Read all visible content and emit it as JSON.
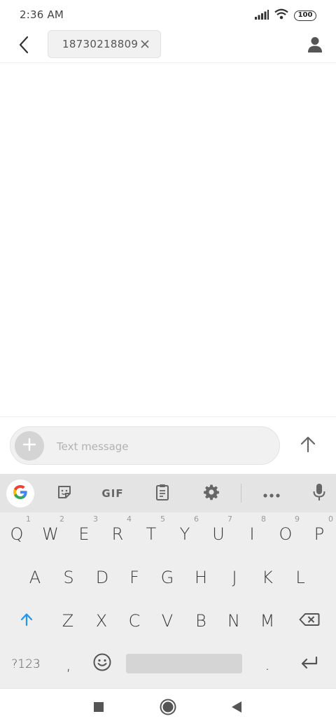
{
  "status_bar": {
    "time": "2:36 AM",
    "battery": "100",
    "icons": [
      "signal-icon",
      "wifi-icon",
      "battery-icon"
    ]
  },
  "header": {
    "recipient": "18730218809",
    "icons": [
      "back-arrow-icon",
      "close-icon",
      "contact-icon"
    ]
  },
  "compose": {
    "placeholder": "Text message",
    "icons": [
      "plus-icon",
      "send-arrow-icon"
    ]
  },
  "keyboard": {
    "toolbar": {
      "gif_label": "GIF",
      "icons": [
        "google-icon",
        "sticker-icon",
        "clipboard-icon",
        "settings-icon",
        "more-icon",
        "mic-icon"
      ]
    },
    "row1": [
      {
        "key": "Q",
        "hint": "1"
      },
      {
        "key": "W",
        "hint": "2"
      },
      {
        "key": "E",
        "hint": "3"
      },
      {
        "key": "R",
        "hint": "4"
      },
      {
        "key": "T",
        "hint": "5"
      },
      {
        "key": "Y",
        "hint": "6"
      },
      {
        "key": "U",
        "hint": "7"
      },
      {
        "key": "I",
        "hint": "8"
      },
      {
        "key": "O",
        "hint": "9"
      },
      {
        "key": "P",
        "hint": "0"
      }
    ],
    "row2": [
      "A",
      "S",
      "D",
      "F",
      "G",
      "H",
      "J",
      "K",
      "L"
    ],
    "row3": [
      "Z",
      "X",
      "C",
      "V",
      "B",
      "N",
      "M"
    ],
    "row4": {
      "symbols": "?123",
      "comma": ",",
      "period": "."
    },
    "icons": [
      "shift-icon",
      "backspace-icon",
      "emoji-icon",
      "enter-icon"
    ]
  },
  "nav_bar": {
    "icons": [
      "recents-icon",
      "home-icon",
      "back-icon"
    ]
  },
  "colors": {
    "accent_shift": "#2196f3",
    "keyboard_bg": "#eeeeee",
    "toolbar_bg": "#e4e4e4"
  }
}
